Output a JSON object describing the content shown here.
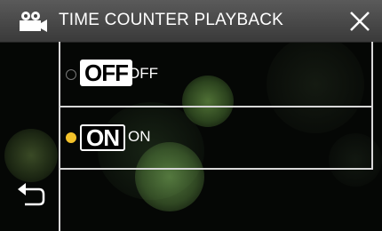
{
  "header": {
    "title": "TIME COUNTER PLAYBACK",
    "mode_icon": "video-camera-icon",
    "close_icon": "close-icon"
  },
  "options": [
    {
      "badge": "OFF",
      "label": "OFF",
      "selected": false
    },
    {
      "badge": "ON",
      "label": "ON",
      "selected": true
    }
  ],
  "footer": {
    "back_icon": "return-arrow-icon"
  },
  "colors": {
    "selected_radio": "#f3c22a",
    "header_bg": "#4a4a4a",
    "frame_lines": "#d8d8d8"
  }
}
